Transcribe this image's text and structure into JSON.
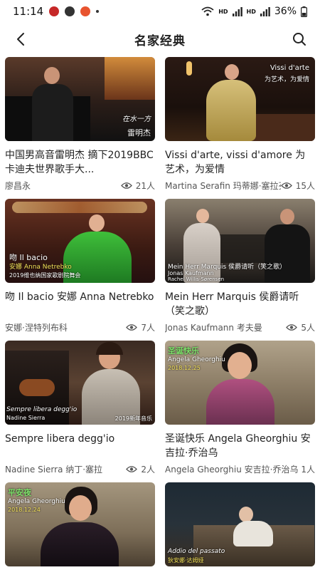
{
  "status": {
    "time": "11:14",
    "battery": "36%",
    "network_tag_1": "HD",
    "network_tag_2": "HD"
  },
  "header": {
    "title": "名家经典"
  },
  "icons": {
    "back": "back-arrow-icon",
    "search": "search-icon",
    "views": "eye-icon"
  },
  "videos": [
    {
      "title": "中国男高音雷明杰 摘下2019BBC卡迪夫世界歌手大...",
      "author": "廖昌永",
      "views": "21人",
      "captions": [
        "雷明杰",
        "在水一方"
      ]
    },
    {
      "title": "Vissi d'arte, vissi d'amore 为艺术，为爱情",
      "author": "Martina Serafin 玛蒂娜·塞拉芬",
      "views": "15人",
      "captions": [
        "Vissi d'arte",
        "为艺术，为爱情"
      ]
    },
    {
      "title": "吻 Il bacio 安娜 Anna Netrebko",
      "author": "安娜·涅特列布科",
      "views": "7人",
      "captions": [
        "吻 Il bacio",
        "安娜 Anna Netrebko",
        "2019维也纳国家歌剧院舞会"
      ]
    },
    {
      "title": "Mein Herr Marquis 侯爵请听（笑之歌）",
      "author": "Jonas Kaufmann 考夫曼",
      "views": "5人",
      "captions": [
        "Mein Herr Marquis 侯爵请听（笑之歌）",
        "Jonas Kaufmann",
        "Rachel Willis-Sørensen"
      ]
    },
    {
      "title": "Sempre libera degg'io",
      "author": "Nadine Sierra 纳丁·塞拉",
      "views": "2人",
      "captions": [
        "Sempre libera degg'io",
        "Nadine Sierra",
        "2019新年音乐"
      ]
    },
    {
      "title": "圣诞快乐 Angela Gheorghiu 安吉拉·乔治乌",
      "author": "Angela Gheorghiu 安吉拉·乔治乌",
      "views": "1人",
      "captions": [
        "圣诞快乐",
        "Angela Gheorghiu",
        "2018.12.25"
      ]
    },
    {
      "title": "",
      "author": "",
      "views": "",
      "captions": [
        "平安夜",
        "Angela Gheorghiu",
        "2018.12.24"
      ]
    },
    {
      "title": "",
      "author": "",
      "views": "",
      "captions": [
        "Addio del passato",
        "狄安娜·达姆娅"
      ]
    }
  ]
}
